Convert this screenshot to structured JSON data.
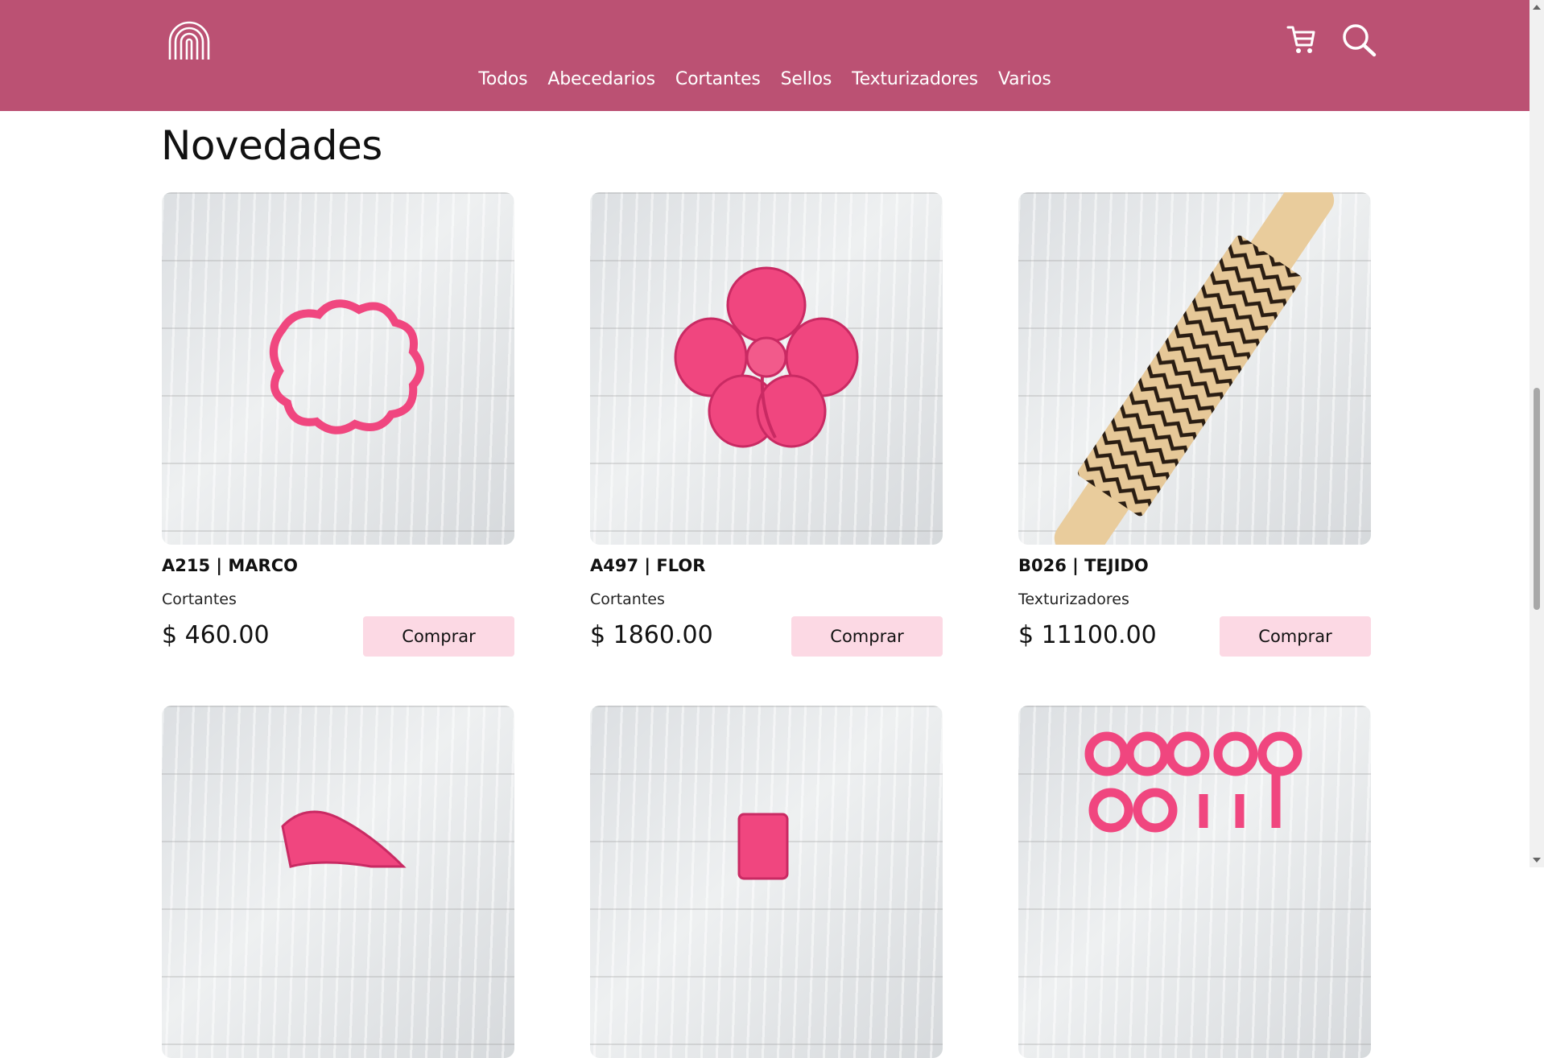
{
  "nav": {
    "items": [
      "Todos",
      "Abecedarios",
      "Cortantes",
      "Sellos",
      "Texturizadores",
      "Varios"
    ]
  },
  "icons": {
    "logo": "rainbow-logo",
    "cart": "cart-icon",
    "search": "search-icon"
  },
  "page_title": "Novedades",
  "buy_label": "Comprar",
  "products": [
    {
      "name": "A215 | MARCO",
      "category": "Cortantes",
      "price": "$ 460.00"
    },
    {
      "name": "A497 | FLOR",
      "category": "Cortantes",
      "price": "$ 1860.00"
    },
    {
      "name": "B026 | TEJIDO",
      "category": "Texturizadores",
      "price": "$ 11100.00"
    }
  ],
  "colors": {
    "header": "#bb5173",
    "button": "#fcd9e4",
    "product_pink": "#f0467f"
  }
}
